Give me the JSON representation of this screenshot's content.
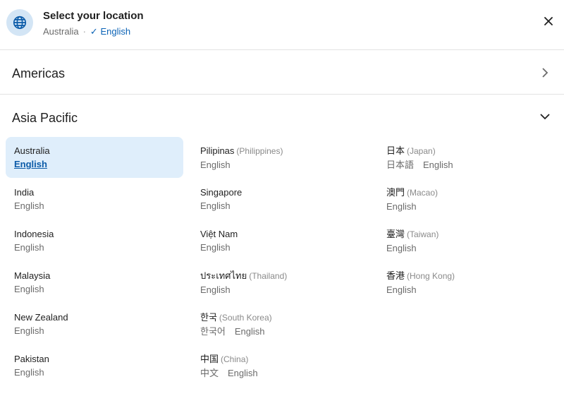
{
  "header": {
    "title": "Select your location",
    "current_country": "Australia",
    "separator": "·",
    "current_language": "English",
    "check_symbol": "✓",
    "icon": "globe-icon",
    "close_icon": "close-icon"
  },
  "regions": {
    "americas": {
      "label": "Americas",
      "icon": "chevron-right-icon"
    },
    "asia_pacific": {
      "label": "Asia Pacific",
      "icon": "chevron-down-icon"
    }
  },
  "columns": [
    [
      {
        "name": "Australia",
        "native": "",
        "langs": [
          "English"
        ],
        "selected": true
      },
      {
        "name": "India",
        "native": "",
        "langs": [
          "English"
        ]
      },
      {
        "name": "Indonesia",
        "native": "",
        "langs": [
          "English"
        ]
      },
      {
        "name": "Malaysia",
        "native": "",
        "langs": [
          "English"
        ]
      },
      {
        "name": "New Zealand",
        "native": "",
        "langs": [
          "English"
        ]
      },
      {
        "name": "Pakistan",
        "native": "",
        "langs": [
          "English"
        ]
      }
    ],
    [
      {
        "name": "Pilipinas",
        "native": "(Philippines)",
        "langs": [
          "English"
        ]
      },
      {
        "name": "Singapore",
        "native": "",
        "langs": [
          "English"
        ]
      },
      {
        "name": "Việt Nam",
        "native": "",
        "langs": [
          "English"
        ]
      },
      {
        "name": "ประเทศไทย",
        "native": "(Thailand)",
        "langs": [
          "English"
        ]
      },
      {
        "name": "한국",
        "native": "(South Korea)",
        "langs": [
          "한국어",
          "English"
        ]
      },
      {
        "name": "中国",
        "native": "(China)",
        "langs": [
          "中文",
          "English"
        ]
      }
    ],
    [
      {
        "name": "日本",
        "native": "(Japan)",
        "langs": [
          "日本語",
          "English"
        ]
      },
      {
        "name": "澳門",
        "native": "(Macao)",
        "langs": [
          "English"
        ]
      },
      {
        "name": "臺灣",
        "native": "(Taiwan)",
        "langs": [
          "English"
        ]
      },
      {
        "name": "香港",
        "native": "(Hong Kong)",
        "langs": [
          "English"
        ]
      }
    ]
  ],
  "colors": {
    "accent": "#0b63b6",
    "selected_bg": "#dfeefb",
    "globe_bg": "#d3e5f5"
  }
}
